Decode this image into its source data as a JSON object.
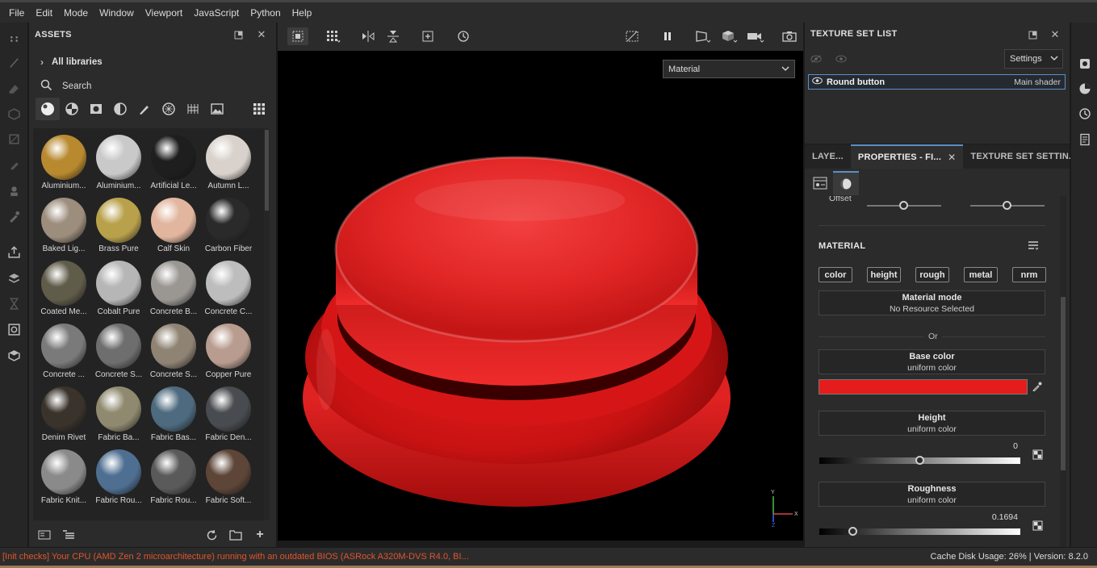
{
  "menubar": {
    "items": [
      "File",
      "Edit",
      "Mode",
      "Window",
      "Viewport",
      "JavaScript",
      "Python",
      "Help"
    ]
  },
  "assets": {
    "title": "ASSETS",
    "all_libraries": "All libraries",
    "search_placeholder": "Search",
    "items": [
      {
        "name": "Aluminium...",
        "color": "#b8892f"
      },
      {
        "name": "Aluminium...",
        "color": "#c9c9c9"
      },
      {
        "name": "Artificial Le...",
        "color": "#1e1e1e"
      },
      {
        "name": "Autumn L...",
        "color": "#d9d2cc"
      },
      {
        "name": "Baked Lig...",
        "color": "#9c8d7c"
      },
      {
        "name": "Brass Pure",
        "color": "#b9a14c"
      },
      {
        "name": "Calf Skin",
        "color": "#e1b59e"
      },
      {
        "name": "Carbon Fiber",
        "color": "#2a2a2a"
      },
      {
        "name": "Coated Me...",
        "color": "#605c4a"
      },
      {
        "name": "Cobalt Pure",
        "color": "#b6b6b6"
      },
      {
        "name": "Concrete B...",
        "color": "#9a9793"
      },
      {
        "name": "Concrete C...",
        "color": "#bdbdbd"
      },
      {
        "name": "Concrete ...",
        "color": "#7a7a7a"
      },
      {
        "name": "Concrete S...",
        "color": "#6e6e6e"
      },
      {
        "name": "Concrete S...",
        "color": "#8f8373"
      },
      {
        "name": "Copper Pure",
        "color": "#b89c8f"
      },
      {
        "name": "Denim Rivet",
        "color": "#3a332c"
      },
      {
        "name": "Fabric Ba...",
        "color": "#8f8a6f"
      },
      {
        "name": "Fabric Bas...",
        "color": "#4d6a7e"
      },
      {
        "name": "Fabric Den...",
        "color": "#484b4f"
      },
      {
        "name": "Fabric Knit...",
        "color": "#8a8a8a"
      },
      {
        "name": "Fabric Rou...",
        "color": "#4f6f92"
      },
      {
        "name": "Fabric Rou...",
        "color": "#5a5a5a"
      },
      {
        "name": "Fabric Soft...",
        "color": "#5d4537"
      }
    ]
  },
  "viewport": {
    "channel": "Material"
  },
  "texture_set_list": {
    "title": "TEXTURE SET LIST",
    "settings_label": "Settings",
    "set_name": "Round button",
    "shader": "Main shader"
  },
  "tabs": [
    "LAYE...",
    "PROPERTIES - FI...",
    "TEXTURE SET SETTIN..."
  ],
  "properties": {
    "offset_label": "Offset",
    "material_title": "MATERIAL",
    "channels": [
      "color",
      "height",
      "rough",
      "metal",
      "nrm"
    ],
    "material_mode": {
      "title": "Material mode",
      "value": "No Resource Selected"
    },
    "or_label": "Or",
    "base_color": {
      "title": "Base color",
      "value": "uniform color",
      "swatch": "#e51c1c"
    },
    "height": {
      "title": "Height",
      "value": "uniform color",
      "number": "0"
    },
    "roughness": {
      "title": "Roughness",
      "value": "uniform color",
      "number": "0.1694"
    }
  },
  "status": {
    "message": "[Init checks] Your CPU (AMD Zen 2 microarchitecture) running with an outdated BIOS (ASRock A320M-DVS R4.0, BI...",
    "right": "Cache Disk Usage:    26% | Version: 8.2.0"
  }
}
